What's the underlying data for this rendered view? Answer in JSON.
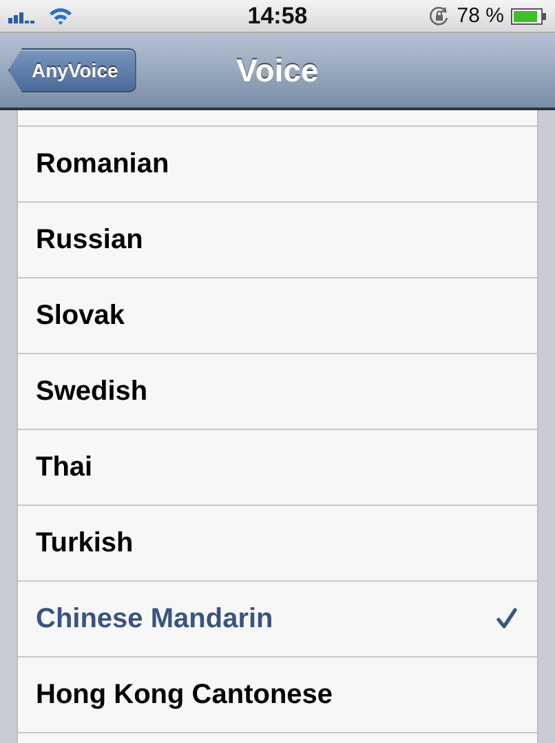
{
  "status_bar": {
    "time": "14:58",
    "battery": "78 %"
  },
  "nav_bar": {
    "back": "AnyVoice",
    "title": "Voice"
  },
  "voices": [
    {
      "label": "Romanian",
      "selected": false
    },
    {
      "label": "Russian",
      "selected": false
    },
    {
      "label": "Slovak",
      "selected": false
    },
    {
      "label": "Swedish",
      "selected": false
    },
    {
      "label": "Thai",
      "selected": false
    },
    {
      "label": "Turkish",
      "selected": false
    },
    {
      "label": "Chinese Mandarin",
      "selected": true
    },
    {
      "label": "Hong Kong Cantonese",
      "selected": false
    }
  ]
}
